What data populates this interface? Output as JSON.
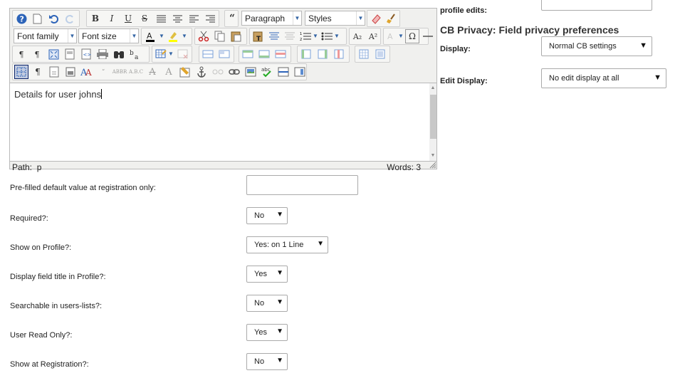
{
  "editor": {
    "block_format": "Paragraph",
    "styles": "Styles",
    "font_family": "Font family",
    "font_size": "Font size",
    "content": "Details for user johns",
    "path_label": "Path:",
    "path_value": "p",
    "word_count": "Words: 3",
    "toolbar_icons": [
      "help-icon",
      "new-document-icon",
      "undo-icon",
      "redo-icon",
      "bold-icon",
      "italic-icon",
      "underline-icon",
      "strikethrough-icon",
      "align-justify-icon",
      "align-center-icon",
      "align-left-icon",
      "align-right-icon",
      "blockquote-icon",
      "eraser-icon",
      "cleanup-icon"
    ],
    "glyphs": {
      "bold": "B",
      "italic": "I",
      "underline": "U",
      "strike": "S",
      "quote": "“",
      "omega": "Ω",
      "sub": "A₂",
      "sup": "A²",
      "pilcrow": "¶",
      "bigA": "A",
      "abc": "abc"
    }
  },
  "form": {
    "prefilled_label": "Pre-filled default value at registration only:",
    "prefilled_value": "",
    "required_label": "Required?:",
    "required_value": "No",
    "show_on_profile_label": "Show on Profile?:",
    "show_on_profile_value": "Yes: on 1 Line",
    "display_title_label": "Display field title in Profile?:",
    "display_title_value": "Yes",
    "searchable_label": "Searchable in users-lists?:",
    "searchable_value": "No",
    "read_only_label": "User Read Only?:",
    "read_only_value": "Yes",
    "show_registration_label": "Show at Registration?:",
    "show_registration_value": "No"
  },
  "right_panel": {
    "cutoff_label": "profile edits:",
    "privacy_title": "CB Privacy: Field privacy preferences",
    "display_label": "Display:",
    "display_value": "Normal CB settings",
    "edit_display_label": "Edit Display:",
    "edit_display_value": "No edit display at all"
  },
  "caret_glyph": "▼"
}
